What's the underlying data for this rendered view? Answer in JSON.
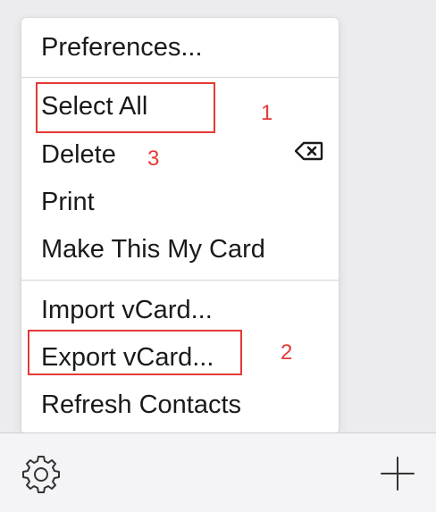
{
  "menu": {
    "items": [
      {
        "label": "Preferences..."
      },
      {
        "label": "Select All"
      },
      {
        "label": "Delete"
      },
      {
        "label": "Print"
      },
      {
        "label": "Make This My Card"
      },
      {
        "label": "Import vCard..."
      },
      {
        "label": "Export vCard..."
      },
      {
        "label": "Refresh Contacts"
      }
    ],
    "delete_shortcut_icon": "delete-backward-key-icon"
  },
  "toolbar": {
    "settings_icon": "gear-icon",
    "add_icon": "plus-icon"
  },
  "annotations": {
    "markers": [
      "1",
      "2",
      "3"
    ],
    "color": "#e53935"
  }
}
